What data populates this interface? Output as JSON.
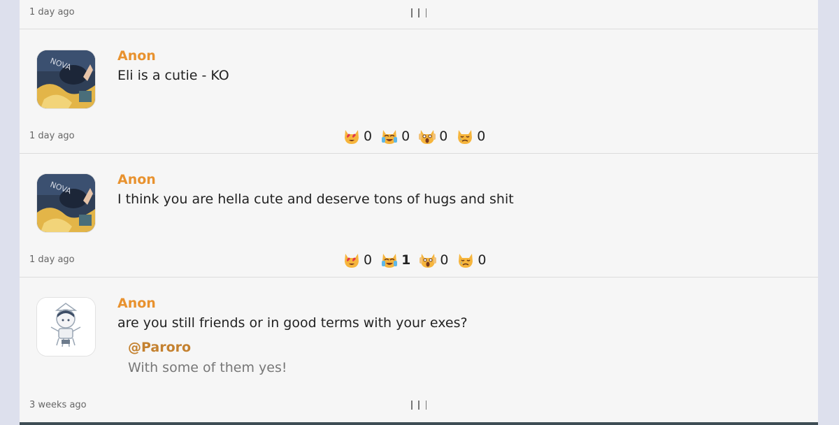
{
  "top": {
    "time": "1 day ago"
  },
  "posts": [
    {
      "author": "Anon",
      "message": "Eli is a cutie - KO",
      "time": "1 day ago",
      "reactions": [
        {
          "icon": "heart-eyes-cat-icon",
          "count": "0"
        },
        {
          "icon": "joy-cat-icon",
          "count": "0"
        },
        {
          "icon": "scream-cat-icon",
          "count": "0"
        },
        {
          "icon": "crying-cat-icon",
          "count": "0"
        }
      ]
    },
    {
      "author": "Anon",
      "message": "I think you are hella cute and deserve tons of hugs and shit",
      "time": "1 day ago",
      "reactions": [
        {
          "icon": "heart-eyes-cat-icon",
          "count": "0"
        },
        {
          "icon": "joy-cat-icon",
          "count": "1"
        },
        {
          "icon": "scream-cat-icon",
          "count": "0"
        },
        {
          "icon": "crying-cat-icon",
          "count": "0"
        }
      ]
    },
    {
      "author": "Anon",
      "message": "are you still friends or in good terms with your exes?",
      "reply": {
        "name": "@Paroro",
        "text": "With some of them yes!"
      },
      "time": "3 weeks ago"
    }
  ],
  "colors": {
    "author": "#e8922f",
    "reply_name": "#c4812f",
    "page_bg": "#dde0ed",
    "card_bg": "#f6f6f6"
  }
}
